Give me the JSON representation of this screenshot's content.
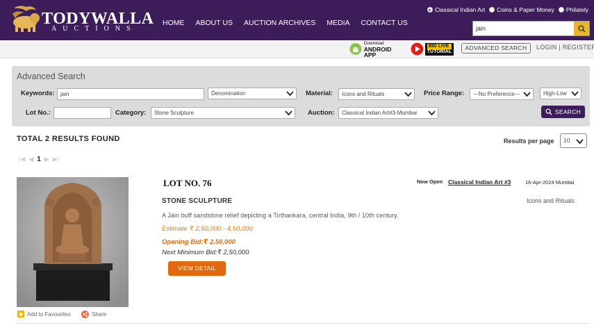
{
  "brand": {
    "name": "TODYWALLA",
    "sub": "AUCTIONS"
  },
  "nav": [
    "HOME",
    "ABOUT US",
    "AUCTION ARCHIVES",
    "MEDIA",
    "CONTACT US"
  ],
  "search_scope": [
    {
      "label": "Classical Indian Art",
      "selected": true
    },
    {
      "label": "Coins & Paper Money",
      "selected": false
    },
    {
      "label": "Philately",
      "selected": false
    }
  ],
  "top_search": {
    "value": "jain"
  },
  "subbar": {
    "android_top": "Download",
    "android_main": "ANDROID APP",
    "bid_top": "BID LIVE",
    "bid_main": "TUTORIAL",
    "advanced_search": "ADVANCED SEARCH",
    "login": "LOGIN | REGISTER"
  },
  "advanced": {
    "title": "Advanced Search",
    "keywords_label": "Keywords:",
    "keywords_value": "jain",
    "denomination": "Denomination",
    "material_label": "Material:",
    "material_value": "Icons and Rituals",
    "price_label": "Price Range:",
    "price_value": "---No Preference---",
    "sort_value": "High-Low",
    "lot_label": "Lot No.:",
    "lot_value": "",
    "category_label": "Category:",
    "category_value": "Stone Sculpture",
    "auction_label": "Auction:",
    "auction_value": "Classical Indian Art#3-Mumbai",
    "search_button": "SEARCH"
  },
  "results": {
    "total": "TOTAL 2 RESULTS FOUND",
    "per_page_label": "Results per page",
    "per_page_value": "10",
    "current_page": "1"
  },
  "lot": {
    "number": "LOT NO. 76",
    "status": "Now Open",
    "auction": "Classical Indian Art #3",
    "date_place": "16-Apr-2024 Mumbai",
    "title": "STONE SCULPTURE",
    "category": "Icons and Rituals",
    "description": "A Jain buff sandstone relief depicting a Tirthankara, central India, 9th / 10th century.",
    "estimate": "Estimate ₹ 2,50,000 - 4,50,000",
    "opening_bid": "Opening Bid:₹  2,50,000",
    "next_bid": "Next Minimum Bid:₹  2,50,000",
    "view_button": "VIEW DETAIL",
    "favourite": "Add to Favourites",
    "share": "Share"
  },
  "colors": {
    "header": "#3c1d5a",
    "accent": "#e06a10",
    "search_icon_bg": "#e8b530"
  }
}
